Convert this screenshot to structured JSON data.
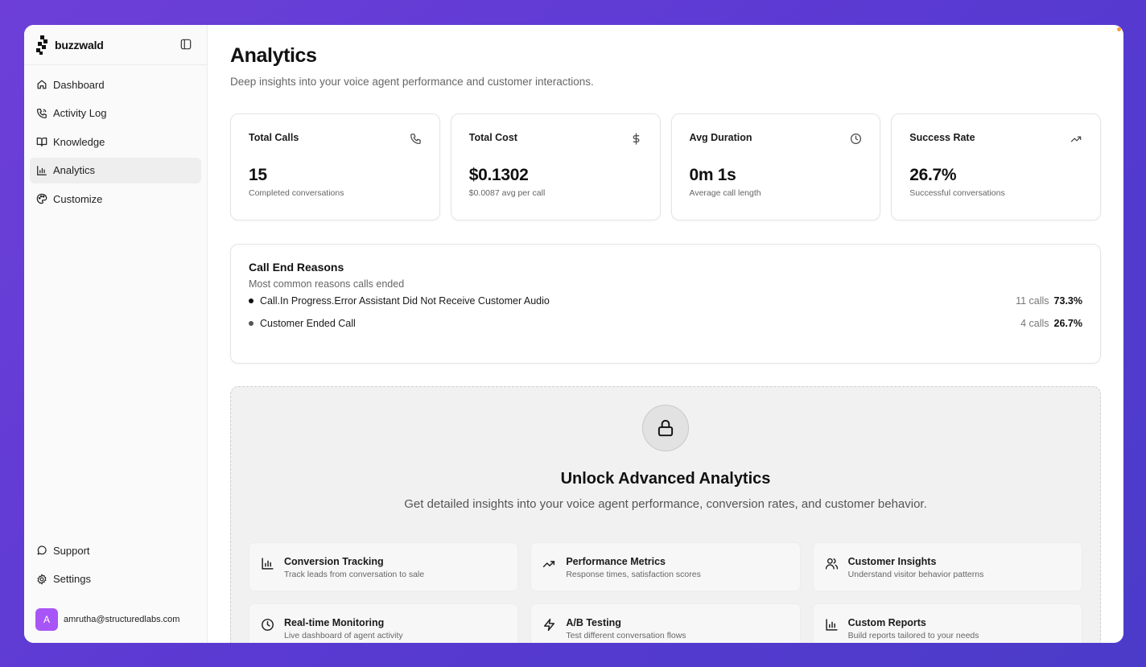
{
  "brand": {
    "name": "buzzwald"
  },
  "sidebar": {
    "items": [
      {
        "label": "Dashboard",
        "icon": "home-icon"
      },
      {
        "label": "Activity Log",
        "icon": "phone-icon"
      },
      {
        "label": "Knowledge",
        "icon": "book-icon"
      },
      {
        "label": "Analytics",
        "icon": "bar-chart-icon",
        "active": true
      },
      {
        "label": "Customize",
        "icon": "palette-icon"
      }
    ],
    "bottom": [
      {
        "label": "Support",
        "icon": "chat-bubble-icon"
      },
      {
        "label": "Settings",
        "icon": "gear-icon"
      }
    ],
    "user": {
      "initial": "A",
      "email": "amrutha@structuredlabs.com",
      "avatar_color": "#a855f7"
    }
  },
  "header": {
    "title": "Analytics",
    "subtitle": "Deep insights into your voice agent performance and customer interactions."
  },
  "stats": [
    {
      "label": "Total Calls",
      "value": "15",
      "desc": "Completed conversations",
      "icon": "phone-icon"
    },
    {
      "label": "Total Cost",
      "value": "$0.1302",
      "desc": "$0.0087 avg per call",
      "icon": "dollar-icon"
    },
    {
      "label": "Avg Duration",
      "value": "0m 1s",
      "desc": "Average call length",
      "icon": "clock-icon"
    },
    {
      "label": "Success Rate",
      "value": "26.7%",
      "desc": "Successful conversations",
      "icon": "trending-up-icon"
    }
  ],
  "reasons": {
    "title": "Call End Reasons",
    "subtitle": "Most common reasons calls ended",
    "rows": [
      {
        "name": "Call.In Progress.Error Assistant Did Not Receive Customer Audio",
        "count": "11 calls",
        "pct": "73.3%"
      },
      {
        "name": "Customer Ended Call",
        "count": "4 calls",
        "pct": "26.7%"
      }
    ]
  },
  "locked": {
    "title": "Unlock Advanced Analytics",
    "subtitle": "Get detailed insights into your voice agent performance, conversion rates, and customer behavior.",
    "features": [
      {
        "title": "Conversion Tracking",
        "desc": "Track leads from conversation to sale",
        "icon": "bar-chart-icon"
      },
      {
        "title": "Performance Metrics",
        "desc": "Response times, satisfaction scores",
        "icon": "trending-up-icon"
      },
      {
        "title": "Customer Insights",
        "desc": "Understand visitor behavior patterns",
        "icon": "users-icon"
      },
      {
        "title": "Real-time Monitoring",
        "desc": "Live dashboard of agent activity",
        "icon": "clock-icon"
      },
      {
        "title": "A/B Testing",
        "desc": "Test different conversation flows",
        "icon": "lightning-icon"
      },
      {
        "title": "Custom Reports",
        "desc": "Build reports tailored to your needs",
        "icon": "bar-chart-icon"
      }
    ]
  }
}
